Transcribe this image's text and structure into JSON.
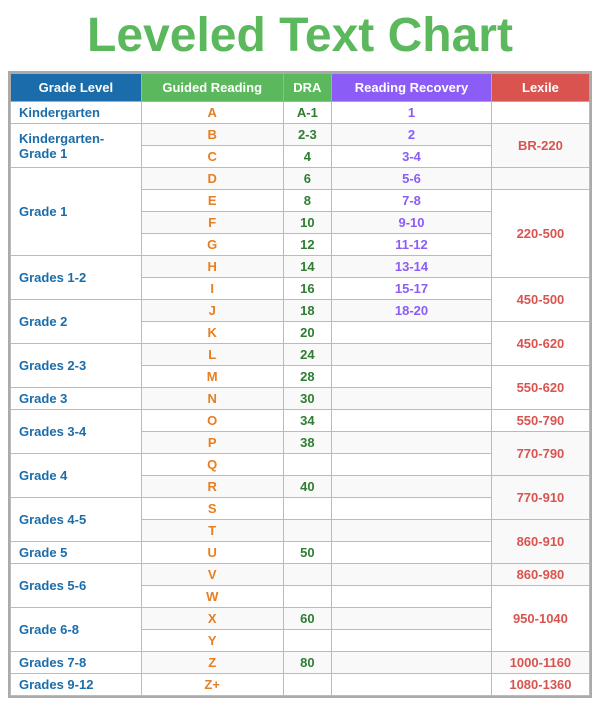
{
  "title": "Leveled Text Chart",
  "headers": {
    "grade_level": "Grade Level",
    "guided_reading": "Guided Reading",
    "dra": "DRA",
    "reading_recovery": "Reading Recovery",
    "lexile": "Lexile"
  },
  "rows": [
    {
      "grade": "Kindergarten",
      "gr": "A",
      "dra": "A-1",
      "rr": "1",
      "lexile": ""
    },
    {
      "grade": "Kindergarten-\nGrade 1",
      "gr": "B",
      "dra": "2-3",
      "rr": "2",
      "lexile": "BR-220",
      "lexile_rowspan": 2
    },
    {
      "grade": "",
      "gr": "C",
      "dra": "4",
      "rr": "3-4",
      "lexile": ""
    },
    {
      "grade": "Grade 1",
      "gr": "D",
      "dra": "6",
      "rr": "5-6",
      "lexile": ""
    },
    {
      "grade": "",
      "gr": "E",
      "dra": "8",
      "rr": "7-8",
      "lexile": "220-500",
      "lexile_rowspan": 4
    },
    {
      "grade": "",
      "gr": "F",
      "dra": "10",
      "rr": "9-10",
      "lexile": ""
    },
    {
      "grade": "",
      "gr": "G",
      "dra": "12",
      "rr": "11-12",
      "lexile": ""
    },
    {
      "grade": "Grades 1-2",
      "gr": "H",
      "dra": "14",
      "rr": "13-14",
      "lexile": ""
    },
    {
      "grade": "",
      "gr": "I",
      "dra": "16",
      "rr": "15-17",
      "lexile": "450-500",
      "lexile_rowspan": 2
    },
    {
      "grade": "Grade 2",
      "gr": "J",
      "dra": "18",
      "rr": "18-20",
      "lexile": ""
    },
    {
      "grade": "",
      "gr": "K",
      "dra": "20",
      "rr": "",
      "lexile": "450-620",
      "lexile_rowspan": 2
    },
    {
      "grade": "Grades 2-3",
      "gr": "L",
      "dra": "24",
      "rr": "",
      "lexile": ""
    },
    {
      "grade": "",
      "gr": "M",
      "dra": "28",
      "rr": "",
      "lexile": "550-620",
      "lexile_rowspan": 2
    },
    {
      "grade": "Grade 3",
      "gr": "N",
      "dra": "30",
      "rr": "",
      "lexile": ""
    },
    {
      "grade": "Grades 3-4",
      "gr": "O",
      "dra": "34",
      "rr": "",
      "lexile": "550-790",
      "lexile_rowspan": 2
    },
    {
      "grade": "",
      "gr": "P",
      "dra": "38",
      "rr": "",
      "lexile": ""
    },
    {
      "grade": "Grade 4",
      "gr": "Q",
      "dra": "",
      "rr": "",
      "lexile": "770-790",
      "lexile_rowspan": 2
    },
    {
      "grade": "",
      "gr": "R",
      "dra": "40",
      "rr": "",
      "lexile": ""
    },
    {
      "grade": "Grades 4-5",
      "gr": "S",
      "dra": "",
      "rr": "",
      "lexile": "770-910",
      "lexile_rowspan": 2
    },
    {
      "grade": "",
      "gr": "T",
      "dra": "",
      "rr": "",
      "lexile": ""
    },
    {
      "grade": "Grade 5",
      "gr": "U",
      "dra": "50",
      "rr": "",
      "lexile": "860-910",
      "lexile_rowspan": 2
    },
    {
      "grade": "Grades 5-6",
      "gr": "V",
      "dra": "",
      "rr": "",
      "lexile": ""
    },
    {
      "grade": "",
      "gr": "W",
      "dra": "",
      "rr": "",
      "lexile": "860-980",
      "lexile_rowspan": 2
    },
    {
      "grade": "Grade 6-8",
      "gr": "X",
      "dra": "60",
      "rr": "",
      "lexile": ""
    },
    {
      "grade": "",
      "gr": "Y",
      "dra": "",
      "rr": "",
      "lexile": "950-1040",
      "lexile_rowspan": 2
    },
    {
      "grade": "Grades 7-8",
      "gr": "Z",
      "dra": "80",
      "rr": "",
      "lexile": ""
    },
    {
      "grade": "Grades 9-12",
      "gr": "Z+",
      "dra": "",
      "rr": "",
      "lexile": "1000-1160",
      "lexile_rowspan": 2
    }
  ]
}
